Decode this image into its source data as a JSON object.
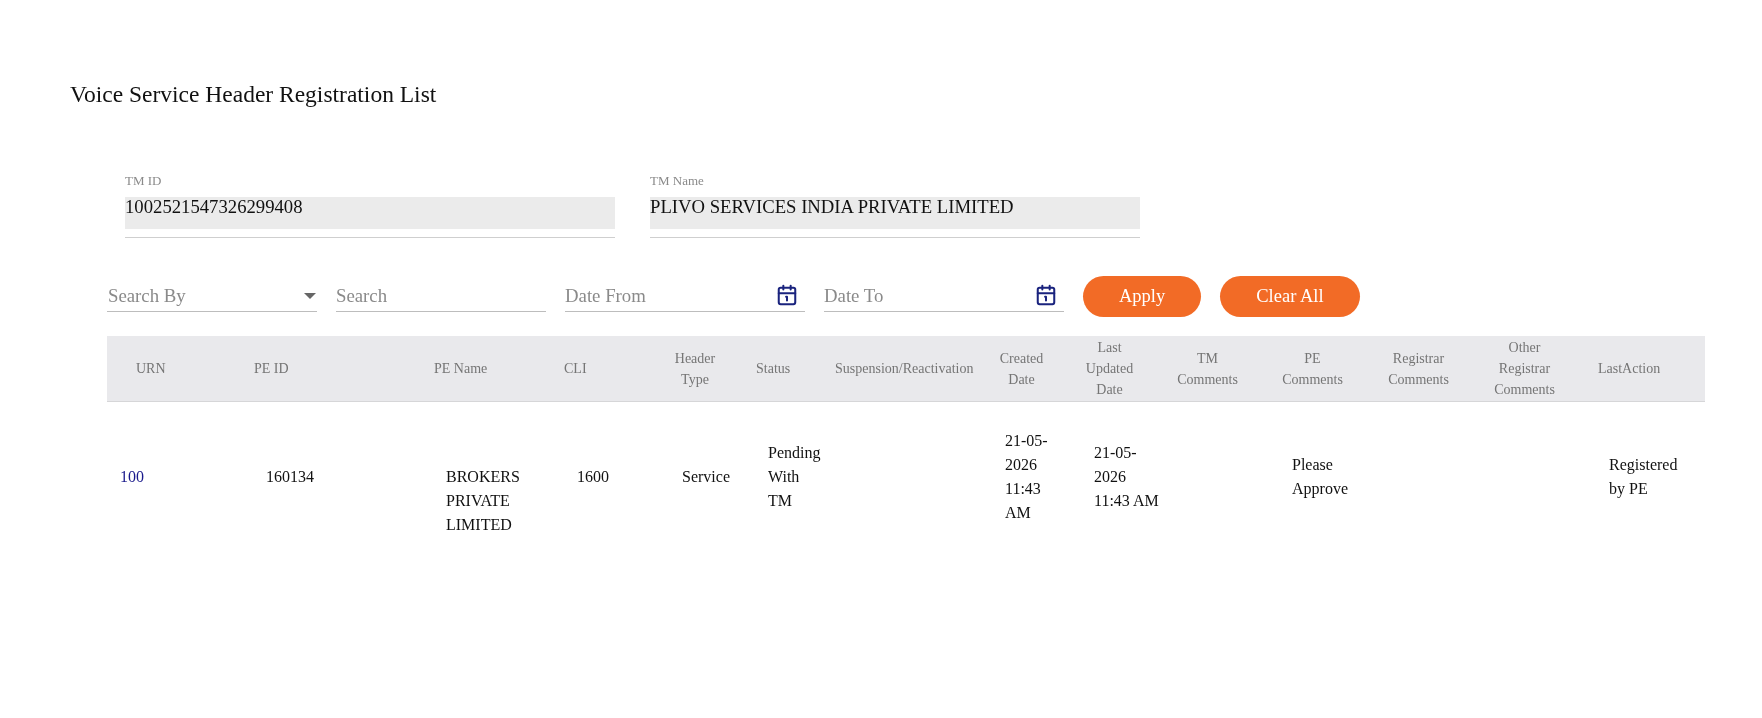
{
  "page": {
    "title": "Voice Service Header Registration List"
  },
  "tm_details": [
    {
      "label": "TM ID",
      "value": "1002521547326299408"
    },
    {
      "label": "TM Name",
      "value": "PLIVO SERVICES INDIA PRIVATE LIMITED"
    }
  ],
  "filters": [
    {
      "kind": "select",
      "placeholder": "Search By"
    },
    {
      "kind": "text",
      "placeholder": "Search"
    },
    {
      "kind": "date",
      "placeholder": "Date From"
    },
    {
      "kind": "date",
      "placeholder": "Date To"
    }
  ],
  "buttons": [
    "Apply",
    "Clear All"
  ],
  "table": {
    "columns": [
      "URN",
      "PE ID",
      "PE Name",
      "CLI",
      "Header Type",
      "Status",
      "Suspension/Reactivation",
      "Created Date",
      "Last Updated Date",
      "TM Comments",
      "PE Comments",
      "Registrar Comments",
      "Other Registrar Comments",
      "LastAction"
    ],
    "rows": [
      {
        "urn": "100",
        "pe_id": "160134",
        "pe_name": "BROKERS PRIVATE LIMITED",
        "cli": "1600",
        "header_type": "Service",
        "status": "Pending With TM",
        "created_date": "21-05-2026 11:43 AM",
        "last_updated_date": "21-05-2026 11:43 AM",
        "pe_comments": "Please Approve",
        "last_action": "Registered by PE"
      }
    ]
  }
}
